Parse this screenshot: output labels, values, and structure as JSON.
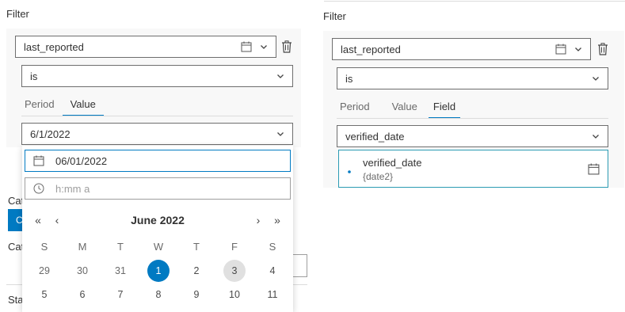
{
  "left": {
    "heading": "Filter",
    "field_select": {
      "value": "last_reported"
    },
    "operator_select": {
      "value": "is"
    },
    "tabs": [
      {
        "label": "Period",
        "active": false
      },
      {
        "label": "Value",
        "active": true
      }
    ],
    "value_select": {
      "value": "6/1/2022"
    },
    "date_input": {
      "value": "06/01/2022"
    },
    "time_input": {
      "placeholder": "h:mm a"
    },
    "calendar": {
      "month_label": "June 2022",
      "nav": {
        "prev_year": "«",
        "prev_month": "‹",
        "next_month": "›",
        "next_year": "»"
      },
      "weekdays": [
        "S",
        "M",
        "T",
        "W",
        "T",
        "F",
        "S"
      ],
      "week1": [
        "29",
        "30",
        "31",
        "1",
        "2",
        "3",
        "4"
      ],
      "week2": [
        "5",
        "6",
        "7",
        "8",
        "9",
        "10",
        "11"
      ],
      "selected_day": "1",
      "today_day": "3"
    },
    "behind_labels": [
      "Cat",
      "Cat",
      "Sta"
    ],
    "behind_button_letter": "C"
  },
  "right": {
    "heading": "Filter",
    "field_select": {
      "value": "last_reported"
    },
    "operator_select": {
      "value": "is"
    },
    "tabs": [
      {
        "label": "Period",
        "active": false
      },
      {
        "label": "Value",
        "active": false
      },
      {
        "label": "Field",
        "active": true
      }
    ],
    "field_value_select": {
      "value": "verified_date"
    },
    "field_option": {
      "name": "verified_date",
      "alias": "{date2}"
    }
  },
  "colors": {
    "accent": "#007ac2",
    "panel": "#f8f8f8",
    "teal_border": "#2b9bb3"
  },
  "icons": [
    "calendar-icon",
    "chevron-down-icon",
    "trash-icon",
    "clock-icon"
  ]
}
